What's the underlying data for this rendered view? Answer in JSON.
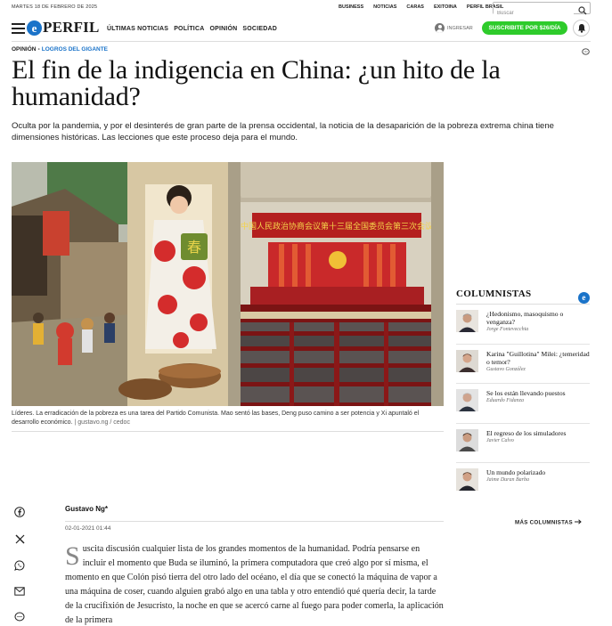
{
  "topbar": {
    "date": "MARTES 18 DE FEBRERO DE 2025",
    "links": [
      "BUSINESS",
      "NOTICIAS",
      "CARAS",
      "EXITOINA",
      "PERFIL BRASIL"
    ],
    "search_placeholder": "Buscar"
  },
  "nav": {
    "logo_letter": "e",
    "logo_text": "PERFIL",
    "links": [
      "ÚLTIMAS NOTICIAS",
      "POLÍTICA",
      "OPINIÓN",
      "SOCIEDAD"
    ],
    "login_label": "INGRESAR",
    "subscribe_label": "SUSCRIBITE POR $26/DÍA"
  },
  "breadcrumb": {
    "section": "OPINIÓN",
    "separator": "•",
    "subsection": "LOGROS DEL GIGANTE"
  },
  "article": {
    "title": "El fin de la indigencia en China: ¿un hito de la humanidad?",
    "lead": "Oculta por la pandemia, y por el desinterés de gran parte de la prensa occidental, la noticia de la desaparición de la pobreza extrema china tiene dimensiones históricas. Las lecciones que este proceso deja para el mundo.",
    "caption": "Líderes. La erradicación de la pobreza es una tarea del Partido Comunista. Mao sentó las bases, Deng puso camino a ser potencia y Xi apuntaló el desarrollo económico.",
    "caption_source": " | gustavo.ng / cedoc",
    "banner_text": "中国人民政治协商会议第十三届全国委员会第三次会议",
    "poster_char": "春",
    "author": "Gustavo Ng*",
    "date": "02-01-2021 01:44",
    "dropcap": "S",
    "body": "uscita discusión cualquier lista de los grandes momentos de la humanidad. Podría pensarse en incluir el momento que Buda se iluminó, la primera computadora que creó algo por sí misma, el momento en que Colón pisó tierra del otro lado del océano, el día que se conectó la máquina de vapor a una máquina de coser, cuando alguien grabó algo en una tabla y otro entendió qué quería decir, la tarde de la crucifixión de Jesucristo, la noche en que se acercó carne al fuego para poder comerla, la aplicación de la primera"
  },
  "sidebar": {
    "title": "COLUMNISTAS",
    "badge": "e",
    "items": [
      {
        "title": "¿Hedonismo, masoquismo o venganza?",
        "author": "Jorge Fontevecchia"
      },
      {
        "title": "Karina \"Guillotina\" Milei: ¿temeridad o temor?",
        "author": "Gustavo González"
      },
      {
        "title": "Se los están llevando puestos",
        "author": "Eduardo Fidanza"
      },
      {
        "title": "El regreso de los simuladores",
        "author": "Javier Calvo"
      },
      {
        "title": "Un mundo polarizado",
        "author": "Jaime Duran Barba"
      }
    ],
    "more_label": "MÁS COLUMNISTAS"
  },
  "share": [
    "facebook-icon",
    "x-icon",
    "whatsapp-icon",
    "email-icon",
    "comment-icon"
  ],
  "colors": {
    "brand_blue": "#1a73c9",
    "subscribe_green": "#2ecb2b"
  }
}
